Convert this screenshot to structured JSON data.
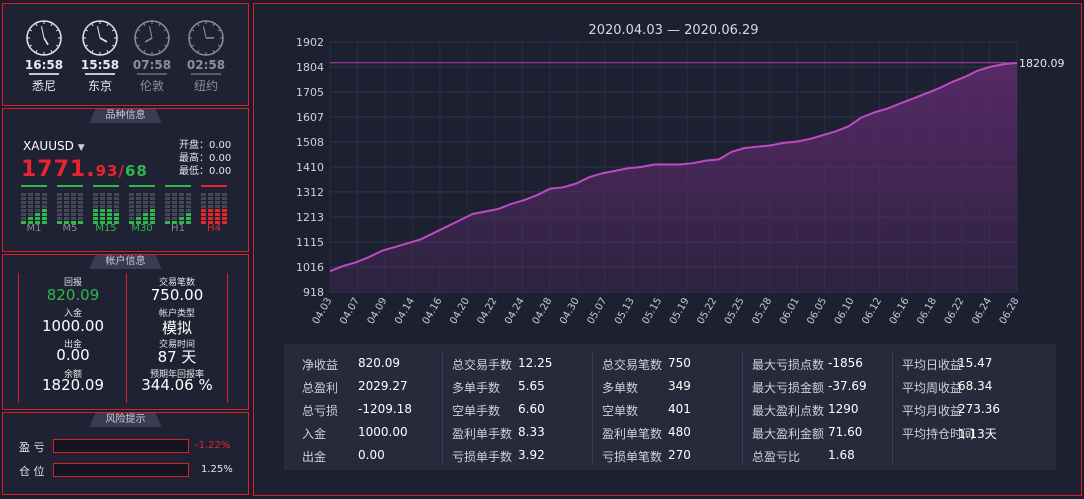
{
  "clocks": [
    {
      "time": "16:58",
      "city": "悉尼",
      "active": true
    },
    {
      "time": "15:58",
      "city": "东京",
      "active": true
    },
    {
      "time": "07:58",
      "city": "伦敦",
      "active": false
    },
    {
      "time": "02:58",
      "city": "纽约",
      "active": false
    }
  ],
  "symbol_panel": {
    "title": "品种信息",
    "symbol": "XAUUSD",
    "price_main": "1771.",
    "price_dec": "93",
    "price_slash": "/",
    "price_sec": "68",
    "open": "开盘：0.00",
    "high": "最高：0.00",
    "low": "最低：0.00",
    "timeframes": [
      {
        "label": "M1",
        "color": "#8a8a94"
      },
      {
        "label": "M5",
        "color": "#8a8a94"
      },
      {
        "label": "M15",
        "color": "#2fb84a"
      },
      {
        "label": "M30",
        "color": "#2fb84a"
      },
      {
        "label": "H1",
        "color": "#8a8a94"
      },
      {
        "label": "H4",
        "color": "#e8242c"
      }
    ]
  },
  "account_panel": {
    "title": "帐户信息",
    "return_label": "回报",
    "return_value": "820.09",
    "deposit_label": "入金",
    "deposit_value": "1000.00",
    "withdraw_label": "出金",
    "withdraw_value": "0.00",
    "balance_label": "余额",
    "balance_value": "1820.09",
    "trades_label": "交易笔数",
    "trades_value": "750.00",
    "type_label": "帐户类型",
    "type_value": "模拟",
    "days_label": "交易时间",
    "days_value": "87 天",
    "annual_label": "预期年回报率",
    "annual_value": "344.06 %",
    "accent": "#2fb84a"
  },
  "risk_panel": {
    "title": "风险提示",
    "profit_label": "盈  亏",
    "profit_value": "-1.22%",
    "position_label": "仓  位",
    "position_value": "1.25%",
    "profit_color": "#e8242c"
  },
  "chart_data": {
    "type": "area",
    "title": "2020.04.03 — 2020.06.29",
    "yticks": [
      "1902",
      "1804",
      "1705",
      "1607",
      "1508",
      "1410",
      "1312",
      "1213",
      "1115",
      "1016",
      "918"
    ],
    "ylim": [
      918,
      1902
    ],
    "xticks": [
      "04.03",
      "04.07",
      "04.09",
      "04.14",
      "04.16",
      "04.20",
      "04.22",
      "04.24",
      "04.28",
      "04.30",
      "05.07",
      "05.13",
      "05.15",
      "05.19",
      "05.22",
      "05.25",
      "05.28",
      "06.01",
      "06.05",
      "06.10",
      "06.12",
      "06.16",
      "06.18",
      "06.22",
      "06.24",
      "06.28"
    ],
    "last_label": "1820.09",
    "values": [
      1000,
      1020,
      1035,
      1055,
      1080,
      1095,
      1110,
      1125,
      1150,
      1175,
      1200,
      1225,
      1235,
      1245,
      1265,
      1280,
      1300,
      1325,
      1330,
      1345,
      1370,
      1385,
      1395,
      1405,
      1410,
      1420,
      1420,
      1420,
      1425,
      1435,
      1440,
      1470,
      1485,
      1490,
      1495,
      1505,
      1510,
      1520,
      1535,
      1550,
      1570,
      1605,
      1625,
      1640,
      1660,
      1680,
      1700,
      1720,
      1745,
      1765,
      1790,
      1805,
      1815,
      1820.09
    ],
    "line_color": "#c04ac4",
    "fill_color": "#5a2a6a"
  },
  "stats": [
    [
      {
        "k": "净收益",
        "v": "820.09"
      },
      {
        "k": "总盈利",
        "v": "2029.27"
      },
      {
        "k": "总亏损",
        "v": "-1209.18"
      },
      {
        "k": "入金",
        "v": "1000.00"
      },
      {
        "k": "出金",
        "v": "0.00"
      }
    ],
    [
      {
        "k": "总交易手数",
        "v": "12.25"
      },
      {
        "k": "多单手数",
        "v": "5.65"
      },
      {
        "k": "空单手数",
        "v": "6.60"
      },
      {
        "k": "盈利单手数",
        "v": "8.33"
      },
      {
        "k": "亏损单手数",
        "v": "3.92"
      }
    ],
    [
      {
        "k": "总交易笔数",
        "v": "750"
      },
      {
        "k": "多单数",
        "v": "349"
      },
      {
        "k": "空单数",
        "v": "401"
      },
      {
        "k": "盈利单笔数",
        "v": "480"
      },
      {
        "k": "亏损单笔数",
        "v": "270"
      }
    ],
    [
      {
        "k": "最大亏损点数",
        "v": "-1856"
      },
      {
        "k": "最大亏损金额",
        "v": "-37.69"
      },
      {
        "k": "最大盈利点数",
        "v": "1290"
      },
      {
        "k": "最大盈利金额",
        "v": "71.60"
      },
      {
        "k": "总盈亏比",
        "v": "1.68"
      }
    ],
    [
      {
        "k": "平均日收益",
        "v": "15.47"
      },
      {
        "k": "平均周收益",
        "v": "68.34"
      },
      {
        "k": "平均月收益",
        "v": "273.36"
      },
      {
        "k": "平均持仓时间",
        "v": "1.13天"
      }
    ]
  ]
}
